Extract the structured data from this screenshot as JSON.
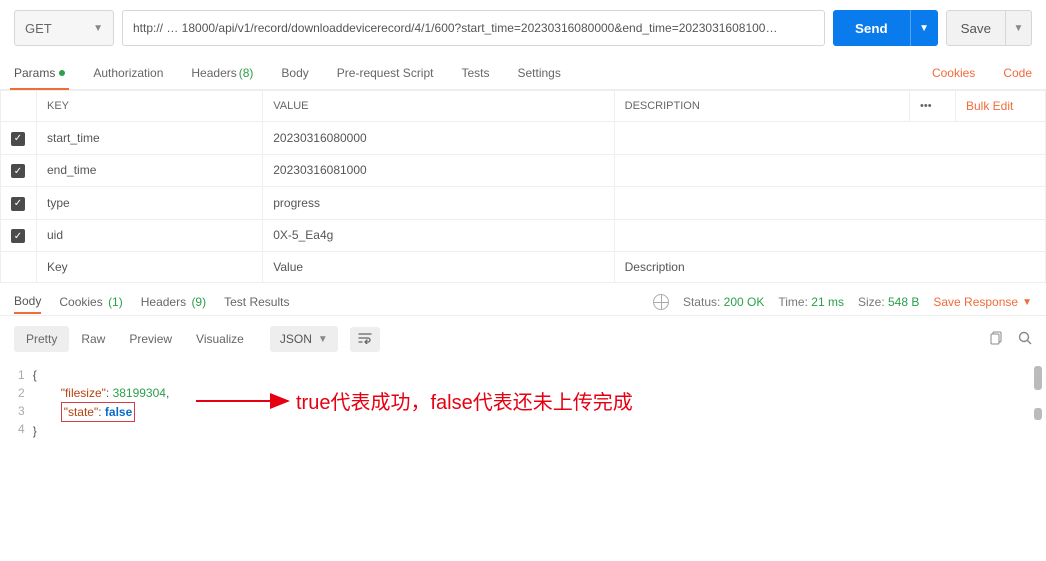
{
  "request": {
    "method": "GET",
    "url": "http:// … 18000/api/v1/record/downloaddevicerecord/4/1/600?start_time=20230316080000&end_time=2023031608100…",
    "send_label": "Send",
    "save_label": "Save"
  },
  "req_tabs": {
    "params": "Params",
    "auth": "Authorization",
    "headers": "Headers",
    "headers_count": "(8)",
    "body": "Body",
    "prerequest": "Pre-request Script",
    "tests": "Tests",
    "settings": "Settings",
    "cookies_link": "Cookies",
    "code_link": "Code"
  },
  "param_headers": {
    "key": "KEY",
    "value": "VALUE",
    "desc": "DESCRIPTION",
    "bulk": "Bulk Edit"
  },
  "params": [
    {
      "key": "start_time",
      "value": "20230316080000"
    },
    {
      "key": "end_time",
      "value": "20230316081000"
    },
    {
      "key": "type",
      "value": "progress"
    },
    {
      "key": "uid",
      "value": "0X-5_Ea4g"
    }
  ],
  "param_placeholders": {
    "key": "Key",
    "value": "Value",
    "desc": "Description"
  },
  "resp_tabs": {
    "body": "Body",
    "cookies": "Cookies",
    "cookies_count": "(1)",
    "headers": "Headers",
    "headers_count": "(9)",
    "tests": "Test Results"
  },
  "status": {
    "status_label": "Status:",
    "status_value": "200 OK",
    "time_label": "Time:",
    "time_value": "21 ms",
    "size_label": "Size:",
    "size_value": "548 B",
    "save_resp": "Save Response"
  },
  "view_opts": {
    "pretty": "Pretty",
    "raw": "Raw",
    "preview": "Preview",
    "visualize": "Visualize",
    "json": "JSON"
  },
  "json_body": {
    "line1": "{",
    "k1": "\"filesize\"",
    "v1": "38199304",
    "k2": "\"state\"",
    "v2": "false",
    "line4": "}"
  },
  "annotation": "true代表成功，false代表还未上传完成",
  "chart_data": {
    "type": "table",
    "title": "Response JSON",
    "data": {
      "filesize": 38199304,
      "state": false
    }
  }
}
